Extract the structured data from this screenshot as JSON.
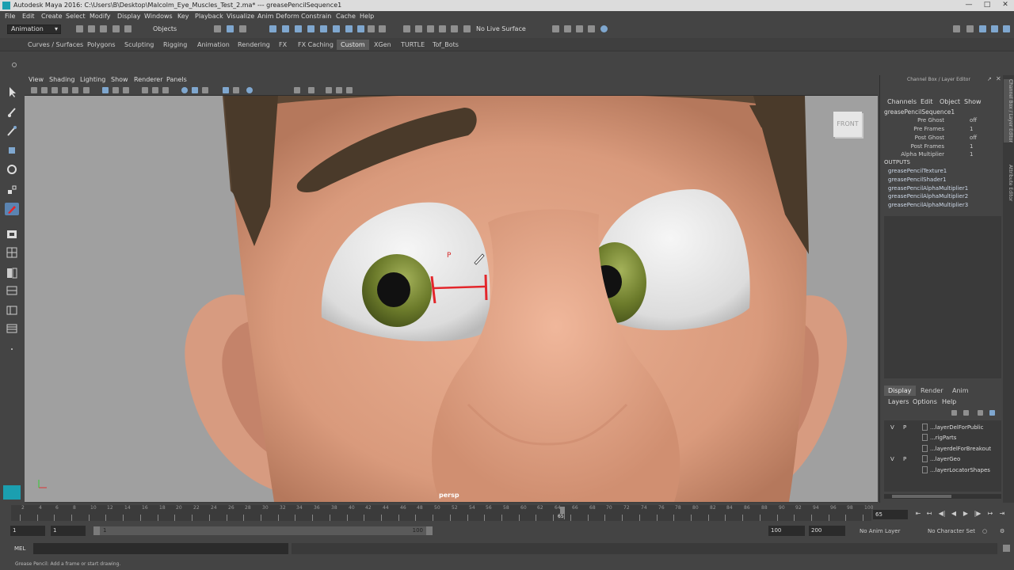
{
  "window": {
    "title": "Autodesk Maya 2016: C:\\Users\\B\\Desktop\\Malcolm_Eye_Muscles_Test_2.ma*   ---   greasePencilSequence1"
  },
  "menubar": [
    "File",
    "Edit",
    "Create",
    "Select",
    "Modify",
    "Display",
    "Windows",
    "Key",
    "Playback",
    "Visualize",
    "Anim Deform",
    "Constrain",
    "Cache",
    "Help"
  ],
  "status_line": {
    "mode": "Animation",
    "selection_mask": "Objects",
    "live_surface": "No Live Surface"
  },
  "shelf_tabs": {
    "items": [
      "Curves / Surfaces",
      "Polygons",
      "Sculpting",
      "Rigging",
      "Animation",
      "Rendering",
      "FX",
      "FX Caching",
      "Custom",
      "XGen",
      "TURTLE",
      "Tof_Bots"
    ],
    "active": "Custom"
  },
  "viewport": {
    "menu": [
      "View",
      "Shading",
      "Lighting",
      "Show",
      "Renderer",
      "Panels"
    ],
    "view_cube_label": "FRONT",
    "camera": "persp",
    "grease_marker": "P",
    "colors": {
      "skin": "#e0a486",
      "hair": "#4a3a2a",
      "iris": "#6c7b2b",
      "sclera": "#e8e8e8",
      "stroke": "#e3262b",
      "background": "#a0a0a0"
    }
  },
  "channel_box": {
    "title": "Channel Box / Layer Editor",
    "menu": [
      "Channels",
      "Edit",
      "Object",
      "Show"
    ],
    "node": "greasePencilSequence1",
    "attributes": [
      {
        "name": "Pre Ghost",
        "value": "off"
      },
      {
        "name": "Pre Frames",
        "value": "1"
      },
      {
        "name": "Post Ghost",
        "value": "off"
      },
      {
        "name": "Post Frames",
        "value": "1"
      },
      {
        "name": "Alpha Multiplier",
        "value": "1"
      }
    ],
    "outputs_label": "OUTPUTS",
    "outputs": [
      "greasePencilTexture1",
      "greasePencilShader1",
      "greasePencilAlphaMultiplier1",
      "greasePencilAlphaMultiplier2",
      "greasePencilAlphaMultiplier3"
    ]
  },
  "side_tabs": [
    "Channel Box / Layer Editor",
    "Attribute Editor"
  ],
  "layer_editor": {
    "tabs": [
      "Display",
      "Render",
      "Anim"
    ],
    "active_tab": "Display",
    "menu": [
      "Layers",
      "Options",
      "Help"
    ],
    "layers": [
      {
        "v": "V",
        "p": "P",
        "name": "...layerDelForPublic"
      },
      {
        "v": "",
        "p": "",
        "name": "...rigParts"
      },
      {
        "v": "",
        "p": "",
        "name": "...layerdelForBreakout"
      },
      {
        "v": "V",
        "p": "P",
        "name": "...layerGeo"
      },
      {
        "v": "",
        "p": "",
        "name": "...layerLocatorShapes"
      }
    ]
  },
  "timeline": {
    "ticks": [
      "2",
      "4",
      "6",
      "8",
      "10",
      "12",
      "14",
      "16",
      "18",
      "20",
      "22",
      "24",
      "26",
      "28",
      "30",
      "32",
      "34",
      "36",
      "38",
      "40",
      "42",
      "44",
      "46",
      "48",
      "50",
      "52",
      "54",
      "56",
      "58",
      "60",
      "62",
      "64",
      "66",
      "68",
      "70",
      "72",
      "74",
      "76",
      "78",
      "80",
      "82",
      "84",
      "86",
      "88",
      "90",
      "92",
      "94",
      "96",
      "98",
      "100"
    ],
    "current_frame": "65",
    "current_frame_field": "65"
  },
  "range": {
    "start_field": "1",
    "start_inner": "1",
    "slider_start": "1",
    "slider_end": "100",
    "end_inner": "100",
    "end_field": "200",
    "anim_layer": "No Anim Layer",
    "character_set": "No Character Set"
  },
  "command_line": {
    "label": "MEL"
  },
  "help_line": "Grease Pencil: Add a frame or start drawing."
}
